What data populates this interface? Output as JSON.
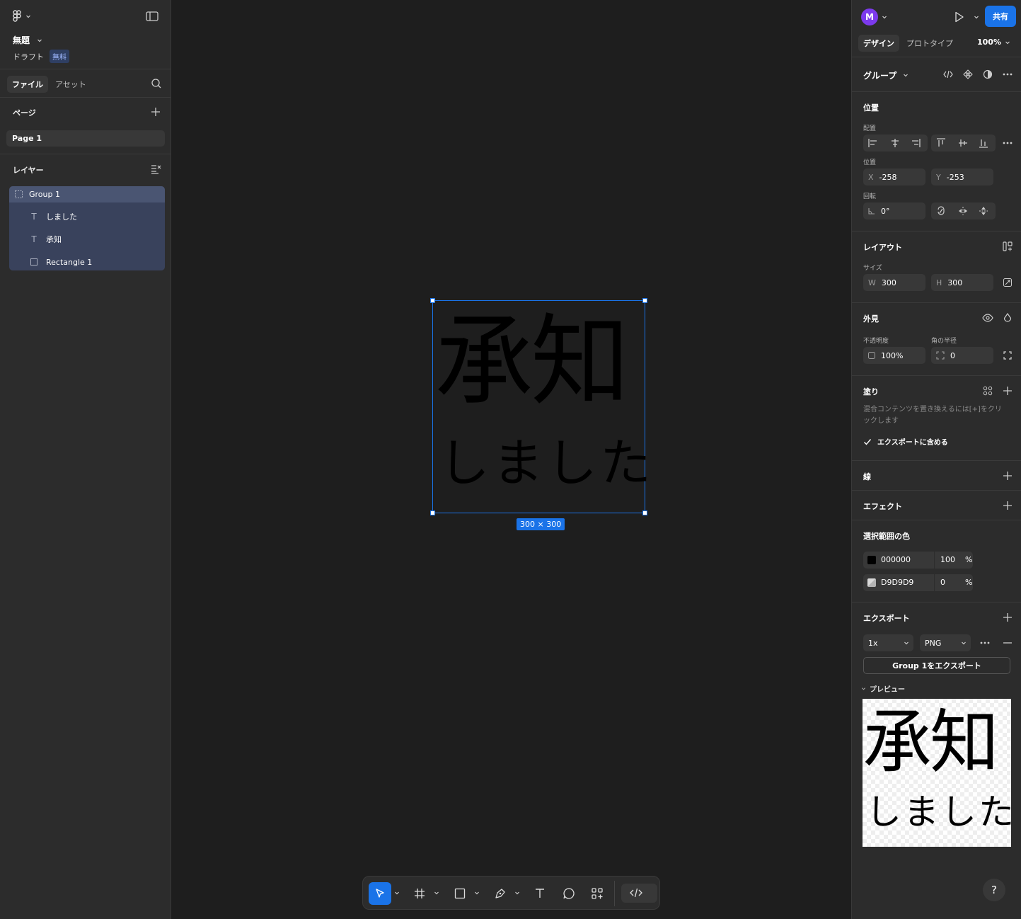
{
  "file": {
    "title": "無題",
    "draft": "ドラフト",
    "plan_badge": "無料"
  },
  "left_tabs": {
    "file": "ファイル",
    "assets": "アセット"
  },
  "pages": {
    "title": "ページ",
    "items": [
      "Page 1"
    ]
  },
  "layers": {
    "title": "レイヤー",
    "items": [
      {
        "name": "Group 1",
        "type": "group"
      },
      {
        "name": "しました",
        "type": "text"
      },
      {
        "name": "承知",
        "type": "text"
      },
      {
        "name": "Rectangle 1",
        "type": "rectangle"
      }
    ]
  },
  "canvas": {
    "kanji": "承知",
    "kana": "しました",
    "size_label": "300 × 300"
  },
  "header": {
    "avatar_initial": "M",
    "share": "共有",
    "tab_design": "デザイン",
    "tab_prototype": "プロトタイプ",
    "zoom": "100%"
  },
  "selection": {
    "type_label": "グループ"
  },
  "position": {
    "title": "位置",
    "align_label": "配置",
    "pos_label": "位置",
    "x_prefix": "X",
    "x": "-258",
    "y_prefix": "Y",
    "y": "-253",
    "rotation_label": "回転",
    "rotation": "0°"
  },
  "layout": {
    "title": "レイアウト",
    "size_label": "サイズ",
    "w_prefix": "W",
    "w": "300",
    "h_prefix": "H",
    "h": "300"
  },
  "appearance": {
    "title": "外見",
    "opacity_label": "不透明度",
    "opacity": "100%",
    "radius_label": "角の半径",
    "radius": "0"
  },
  "fill": {
    "title": "塗り",
    "hint": "混合コンテンツを置き換えるには[+]をクリックします",
    "include_export": "エクスポートに含める"
  },
  "stroke": {
    "title": "線"
  },
  "effects": {
    "title": "エフェクト"
  },
  "selection_colors": {
    "title": "選択範囲の色",
    "items": [
      {
        "hex": "000000",
        "opacity": "100",
        "unit": "%",
        "color": "#000000"
      },
      {
        "hex": "D9D9D9",
        "opacity": "0",
        "unit": "%",
        "color": "#D9D9D9"
      }
    ]
  },
  "export": {
    "title": "エクスポート",
    "scale": "1x",
    "format": "PNG",
    "button": "Group 1をエクスポート",
    "preview_label": "プレビュー"
  },
  "colors": {
    "accent": "#1a73e8",
    "avatar": "#7c3aed",
    "panel": "#2c2c2c",
    "canvas": "#1e1e1e"
  }
}
